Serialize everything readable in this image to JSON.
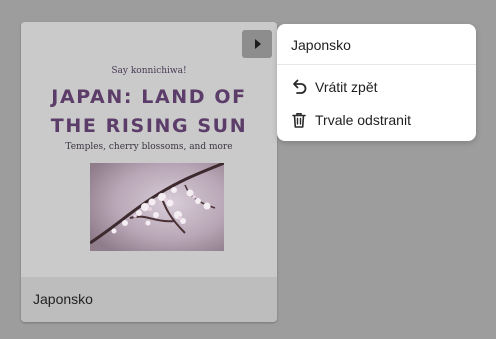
{
  "card": {
    "kicker": "Say konnichiwa!",
    "title_line1": "JAPAN: LAND OF",
    "title_line2": "THE RISING SUN",
    "subtitle": "Temples, cherry blossoms, and more",
    "name": "Japonsko"
  },
  "menu": {
    "title": "Japonsko",
    "items": [
      {
        "label": "Vrátit zpět",
        "icon": "undo-icon"
      },
      {
        "label": "Trvale odstranit",
        "icon": "trash-icon"
      }
    ]
  },
  "colors": {
    "title": "#5c3d6a",
    "background": "#9d9d9d"
  }
}
